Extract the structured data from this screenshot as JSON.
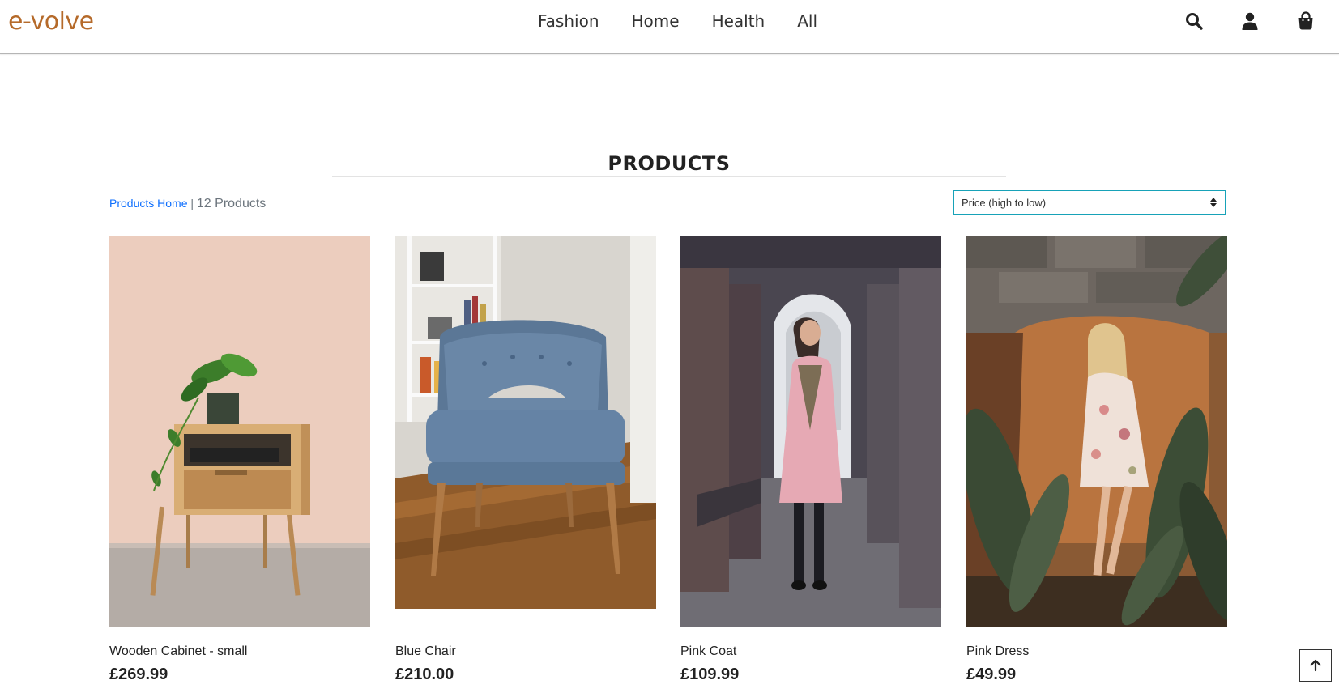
{
  "brand": {
    "logo_text": "e-volve",
    "logo_color": "#b56a2a"
  },
  "nav": {
    "links": [
      "Fashion",
      "Home",
      "Health",
      "All"
    ],
    "icons": [
      "search-icon",
      "user-icon",
      "shopping-bag-icon"
    ]
  },
  "page": {
    "title": "PRODUCTS",
    "breadcrumb_link": "Products Home",
    "separator": "|",
    "product_count": "12 Products",
    "sort_selected": "Price (high to low)"
  },
  "products": [
    {
      "name": "Wooden Cabinet - small",
      "price": "£269.99"
    },
    {
      "name": "Blue Chair",
      "price": "£210.00"
    },
    {
      "name": "Pink Coat",
      "price": "£109.99"
    },
    {
      "name": "Pink Dress",
      "price": "£49.99"
    }
  ],
  "colors": {
    "link": "#0d6efd",
    "select_border": "#17a2b8",
    "text": "#222222"
  },
  "back_to_top_icon": "arrow-up-icon"
}
